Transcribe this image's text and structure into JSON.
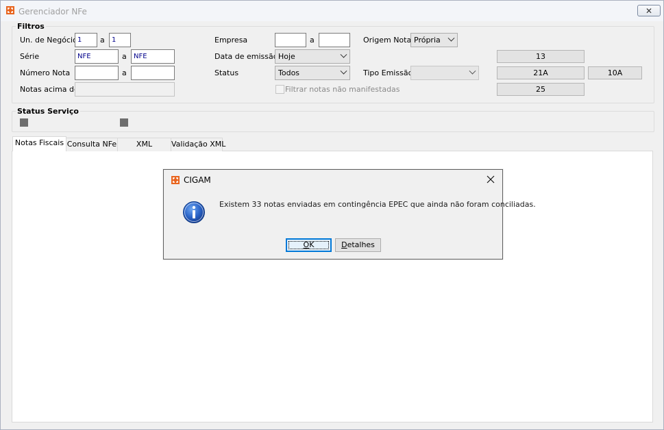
{
  "window": {
    "title": "Gerenciador NFe",
    "close_glyph": "✕"
  },
  "filtros": {
    "title": "Filtros",
    "un_negocio": {
      "label": "Un. de Negócio",
      "from": "1",
      "sep": "a",
      "to": "1"
    },
    "serie": {
      "label": "Série",
      "from": "NFE",
      "sep": "a",
      "to": "NFE"
    },
    "numero_nota": {
      "label": "Número Nota",
      "from": "",
      "sep": "a",
      "to": ""
    },
    "notas_acima": {
      "label": "Notas acima de",
      "value": ""
    },
    "empresa": {
      "label": "Empresa",
      "from": "",
      "sep": "a",
      "to": ""
    },
    "data_emissao": {
      "label": "Data de emissão",
      "value": "Hoje"
    },
    "status": {
      "label": "Status",
      "value": "Todos"
    },
    "filtrar_nao_manifestadas": {
      "label": "Filtrar notas não manifestadas",
      "checked": false
    },
    "origem_nota": {
      "label": "Origem Nota",
      "value": "Própria"
    },
    "tipo_emissao": {
      "label": "Tipo Emissão",
      "value": ""
    },
    "readouts": {
      "r1": "13",
      "r2": "21A",
      "r3": "10A",
      "r4": "25"
    }
  },
  "status_servico": {
    "title": "Status Serviço",
    "indicator_color": "#6e6e6e"
  },
  "tabs": [
    {
      "label": "Notas Fiscais",
      "active": true
    },
    {
      "label": "Consulta NFe",
      "active": false
    },
    {
      "label": "XML",
      "active": false
    },
    {
      "label": "Validação XML",
      "active": false
    }
  ],
  "dialog": {
    "title": "CIGAM",
    "message": "Existem 33 notas enviadas em contingência EPEC que ainda não foram conciliadas.",
    "ok": {
      "pre": "",
      "accel": "O",
      "post": "K"
    },
    "details": {
      "pre": "",
      "accel": "D",
      "post": "etalhes"
    },
    "icon": "info-icon"
  },
  "colors": {
    "logo_orange": "#e8641e",
    "info_blue": "#1f5fc2"
  }
}
